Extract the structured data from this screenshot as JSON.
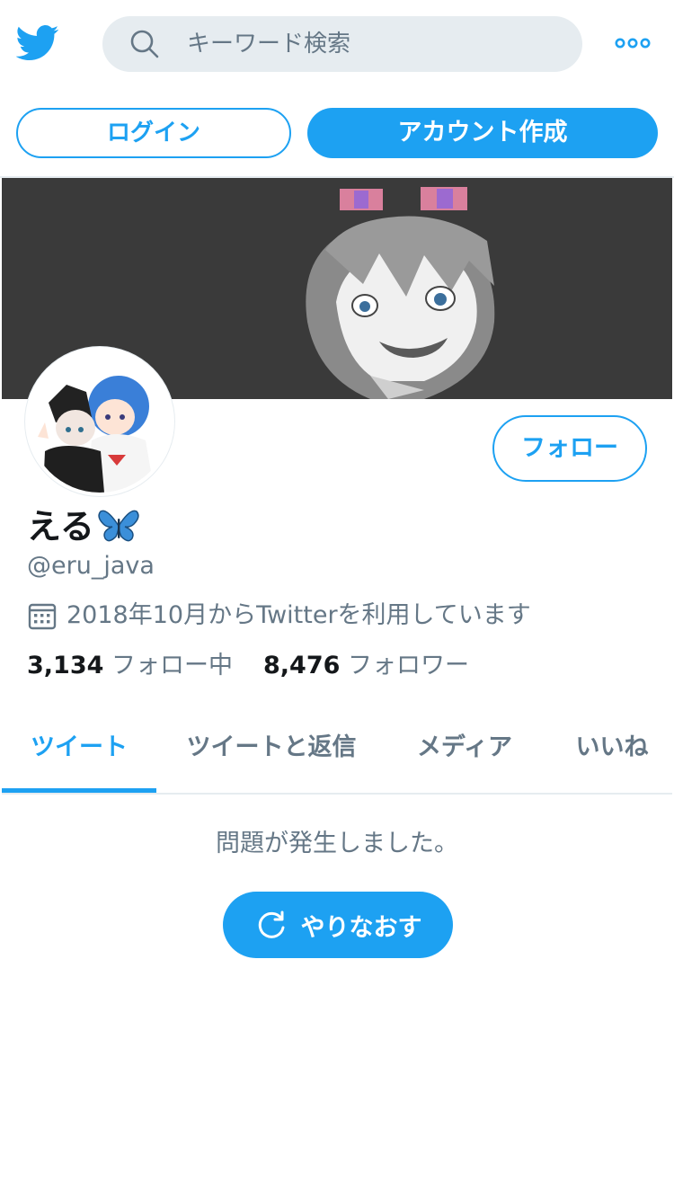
{
  "topbar": {
    "logo_icon": "twitter-bird-icon",
    "search_placeholder": "キーワード検索",
    "more_icon": "more-dots-icon"
  },
  "auth": {
    "login_label": "ログイン",
    "signup_label": "アカウント作成"
  },
  "profile": {
    "name": "える",
    "name_emoji": "butterfly",
    "handle": "@eru_java",
    "joined": "2018年10月からTwitterを利用しています",
    "following_count": "3,134",
    "following_label": "フォロー中",
    "followers_count": "8,476",
    "followers_label": "フォロワー",
    "follow_label": "フォロー"
  },
  "tabs": [
    {
      "label": "ツイート",
      "active": true
    },
    {
      "label": "ツイートと返信",
      "active": false
    },
    {
      "label": "メディア",
      "active": false
    },
    {
      "label": "いいね",
      "active": false
    }
  ],
  "timeline": {
    "error_text": "問題が発生しました。",
    "retry_label": "やりなおす"
  },
  "colors": {
    "accent": "#1da1f2",
    "muted_text": "#657786",
    "banner_bg": "#3a3a3a"
  }
}
